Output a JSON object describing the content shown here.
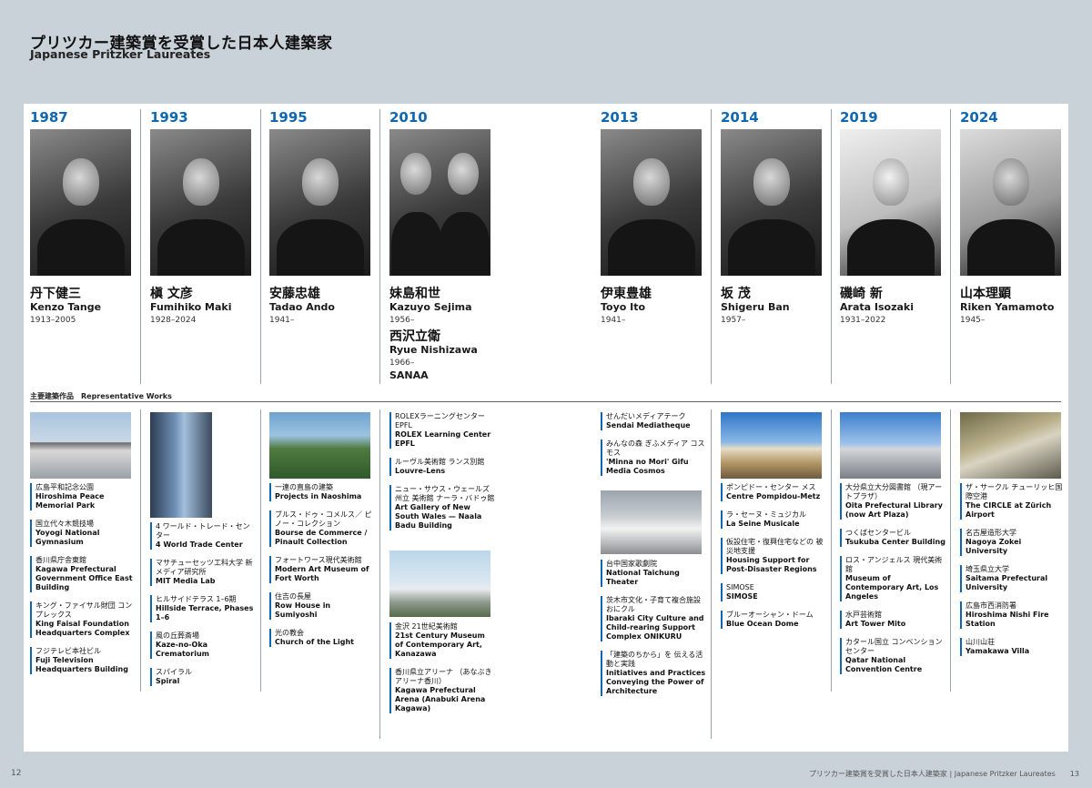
{
  "header": {
    "title_jp": "プリツカー建築賞を受賞した日本人建築家",
    "title_en": "Japanese Pritzker Laureates"
  },
  "section_label": "主要建築作品　Representative Works",
  "laureates": [
    {
      "year": "1987",
      "name_jp": "丹下健三",
      "name_en": "Kenzo Tange",
      "years": "1913–2005"
    },
    {
      "year": "1993",
      "name_jp": "槇 文彦",
      "name_en": "Fumihiko Maki",
      "years": "1928–2024"
    },
    {
      "year": "1995",
      "name_jp": "安藤忠雄",
      "name_en": "Tadao Ando",
      "years": "1941–"
    },
    {
      "year": "2010",
      "name_jp": "妹島和世",
      "name_en": "Kazuyo Sejima",
      "years": "1956–",
      "name2_jp": "西沢立衛",
      "name2_en": "Ryue Nishizawa",
      "years2": "1966–",
      "unit": "SANAA"
    },
    {
      "year": "2013",
      "name_jp": "伊東豊雄",
      "name_en": "Toyo Ito",
      "years": "1941–"
    },
    {
      "year": "2014",
      "name_jp": "坂 茂",
      "name_en": "Shigeru Ban",
      "years": "1957–"
    },
    {
      "year": "2019",
      "name_jp": "磯崎 新",
      "name_en": "Arata Isozaki",
      "years": "1931–2022"
    },
    {
      "year": "2024",
      "name_jp": "山本理顕",
      "name_en": "Riken Yamamoto",
      "years": "1945–"
    }
  ],
  "works": {
    "tange": [
      {
        "jp": "広島平和記念公園",
        "en": "Hiroshima Peace Memorial Park"
      },
      {
        "jp": "国立代々木競技場",
        "en": "Yoyogi National Gymnasium"
      },
      {
        "jp": "香川県庁舎東館",
        "en": "Kagawa Prefectural Government Office East Building"
      },
      {
        "jp": "キング・ファイサル財団 コンプレックス",
        "en": "King Faisal Foundation Headquarters Complex"
      },
      {
        "jp": "フジテレビ本社ビル",
        "en": "Fuji Television Headquarters Building"
      }
    ],
    "maki": [
      {
        "jp": "4 ワールド・トレード・センター",
        "en": "4 World Trade Center"
      },
      {
        "jp": "マサチューセッツ工科大学 新メディア研究所",
        "en": "MIT Media Lab"
      },
      {
        "jp": "ヒルサイドテラス 1–6期",
        "en": "Hillside Terrace, Phases 1–6"
      },
      {
        "jp": "風の丘葬斎場",
        "en": "Kaze-no-Oka Crematorium"
      },
      {
        "jp": "スパイラル",
        "en": "Spiral"
      }
    ],
    "ando": [
      {
        "jp": "一連の直島の建築",
        "en": "Projects in Naoshima"
      },
      {
        "jp": "ブルス・ドゥ・コメルス／ ピノー・コレクション",
        "en": "Bourse de Commerce / Pinault Collection"
      },
      {
        "jp": "フォートワース現代美術館",
        "en": "Modern Art Museum of Fort Worth"
      },
      {
        "jp": "住吉の長屋",
        "en": "Row House in Sumiyoshi"
      },
      {
        "jp": "光の教会",
        "en": "Church of the Light"
      }
    ],
    "sanaa_top": [
      {
        "jp": "ROLEXラーニングセンター EPFL",
        "en": "ROLEX Learning Center EPFL"
      },
      {
        "jp": "ルーヴル美術館 ランス別館",
        "en": "Louvre-Lens"
      },
      {
        "jp": "ニュー・サウス・ウェールズ州立 美術館 ナーラ・バドゥ館",
        "en": "Art Gallery of New South Wales — Naala Badu Building"
      }
    ],
    "sanaa_bottom": [
      {
        "jp": "金沢 21世紀美術館",
        "en": "21st Century Museum of Contemporary Art, Kanazawa"
      },
      {
        "jp": "香川県立アリーナ （あなぶきアリーナ香川）",
        "en": "Kagawa Prefectural Arena (Anabuki Arena Kagawa)"
      }
    ],
    "ito_top": [
      {
        "jp": "せんだいメディアテーク",
        "en": "Sendai Mediatheque"
      },
      {
        "jp": "みんなの森 ぎふメディア コスモス",
        "en": "'Minna no Mori' Gifu Media Cosmos"
      }
    ],
    "ito_bottom": [
      {
        "jp": "台中国家歌劇院",
        "en": "National Taichung Theater"
      },
      {
        "jp": "茨木市文化・子育て複合施設 おにクル",
        "en": "Ibaraki City Culture and Child-rearing Support Complex ONIKURU"
      },
      {
        "jp": "「建築のちから」を 伝える活動と実践",
        "en": "Initiatives and Practices Conveying the Power of Architecture"
      }
    ],
    "ban": [
      {
        "jp": "ポンピドー・センター メス",
        "en": "Centre Pompidou-Metz"
      },
      {
        "jp": "ラ・セーヌ・ミュジカル",
        "en": "La Seine Musicale"
      },
      {
        "jp": "仮設住宅・復興住宅などの 被災地支援",
        "en": "Housing Support for Post-Disaster Regions"
      },
      {
        "jp": "SIMOSE",
        "en": "SIMOSE"
      },
      {
        "jp": "ブルーオーシャン・ドーム",
        "en": "Blue Ocean Dome"
      }
    ],
    "isozaki": [
      {
        "jp": "大分県立大分図書館 （現アートプラザ）",
        "en": "Oita Prefectural Library (now Art Plaza)"
      },
      {
        "jp": "つくばセンタービル",
        "en": "Tsukuba Center Building"
      },
      {
        "jp": "ロス・アンジェルス 現代美術館",
        "en": "Museum of Contemporary Art, Los Angeles"
      },
      {
        "jp": "水戸芸術館",
        "en": "Art Tower Mito"
      },
      {
        "jp": "カタール国立 コンベンションセンター",
        "en": "Qatar National Convention Centre"
      }
    ],
    "yamamoto": [
      {
        "jp": "ザ・サークル チューリッヒ国際空港",
        "en": "The CIRCLE at Zürich Airport"
      },
      {
        "jp": "名古屋造形大学",
        "en": "Nagoya Zokei University"
      },
      {
        "jp": "埼玉県立大学",
        "en": "Saitama Prefectural University"
      },
      {
        "jp": "広島市西消防署",
        "en": "Hiroshima Nishi Fire Station"
      },
      {
        "jp": "山川山荘",
        "en": "Yamakawa Villa"
      }
    ]
  },
  "footer": {
    "page_left": "12",
    "page_right_label": "プリツカー建築賞を受賞した日本人建築家 | Japanese Pritzker Laureates　　13"
  },
  "colors": {
    "accent": "#0f67b1",
    "background": "#c9d1d9"
  }
}
